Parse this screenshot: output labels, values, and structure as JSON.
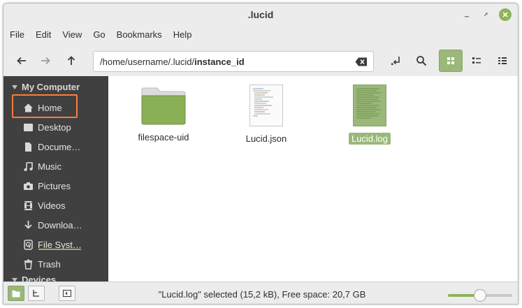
{
  "window": {
    "title": ".lucid",
    "controls": {
      "minimize_icon": "minimize-icon",
      "maximize_icon": "maximize-icon",
      "close_icon": "close-icon"
    }
  },
  "menubar": {
    "items": [
      {
        "label": "File"
      },
      {
        "label": "Edit"
      },
      {
        "label": "View"
      },
      {
        "label": "Go"
      },
      {
        "label": "Bookmarks"
      },
      {
        "label": "Help"
      }
    ]
  },
  "toolbar": {
    "back_icon": "arrow-left-icon",
    "forward_icon": "arrow-right-icon",
    "up_icon": "arrow-up-icon",
    "path_prefix": "/home/username/.lucid/",
    "path_current": "instance_id",
    "clear_icon": "backspace-icon",
    "toggle_location_icon": "location-toggle-icon",
    "search_icon": "search-icon",
    "view_modes": [
      {
        "icon": "grid-view-icon",
        "active": true
      },
      {
        "icon": "list-view-icon",
        "active": false
      },
      {
        "icon": "compact-view-icon",
        "active": false
      }
    ]
  },
  "sidebar": {
    "section_my_computer": "My Computer",
    "items": [
      {
        "label": "Home",
        "icon": "home-icon"
      },
      {
        "label": "Desktop",
        "icon": "desktop-icon"
      },
      {
        "label": "Docume…",
        "icon": "document-icon"
      },
      {
        "label": "Music",
        "icon": "music-icon"
      },
      {
        "label": "Pictures",
        "icon": "camera-icon"
      },
      {
        "label": "Videos",
        "icon": "film-icon"
      },
      {
        "label": "Downloa…",
        "icon": "download-icon"
      },
      {
        "label": "File Syst…",
        "icon": "drive-icon",
        "usage_fraction": 0.55
      },
      {
        "label": "Trash",
        "icon": "trash-icon"
      }
    ],
    "section_devices": "Devices",
    "highlight_color": "#ff7a3c"
  },
  "files": [
    {
      "name": "filespace-uid",
      "type": "folder",
      "selected": false
    },
    {
      "name": "Lucid.json",
      "type": "text-document",
      "selected": false
    },
    {
      "name": "Lucid.log",
      "type": "text-document",
      "selected": true
    }
  ],
  "statusbar": {
    "text": "\"Lucid.log\" selected (15,2 kB), Free space: 20,7 GB",
    "places_icon": "places-icon",
    "tree_icon": "tree-icon",
    "hide_sidebar_icon": "hide-sidebar-icon",
    "zoom_level": 0.5
  },
  "colors": {
    "accent": "#9ab87a",
    "folder": "#8ab055",
    "sidebar_bg": "#404040"
  }
}
